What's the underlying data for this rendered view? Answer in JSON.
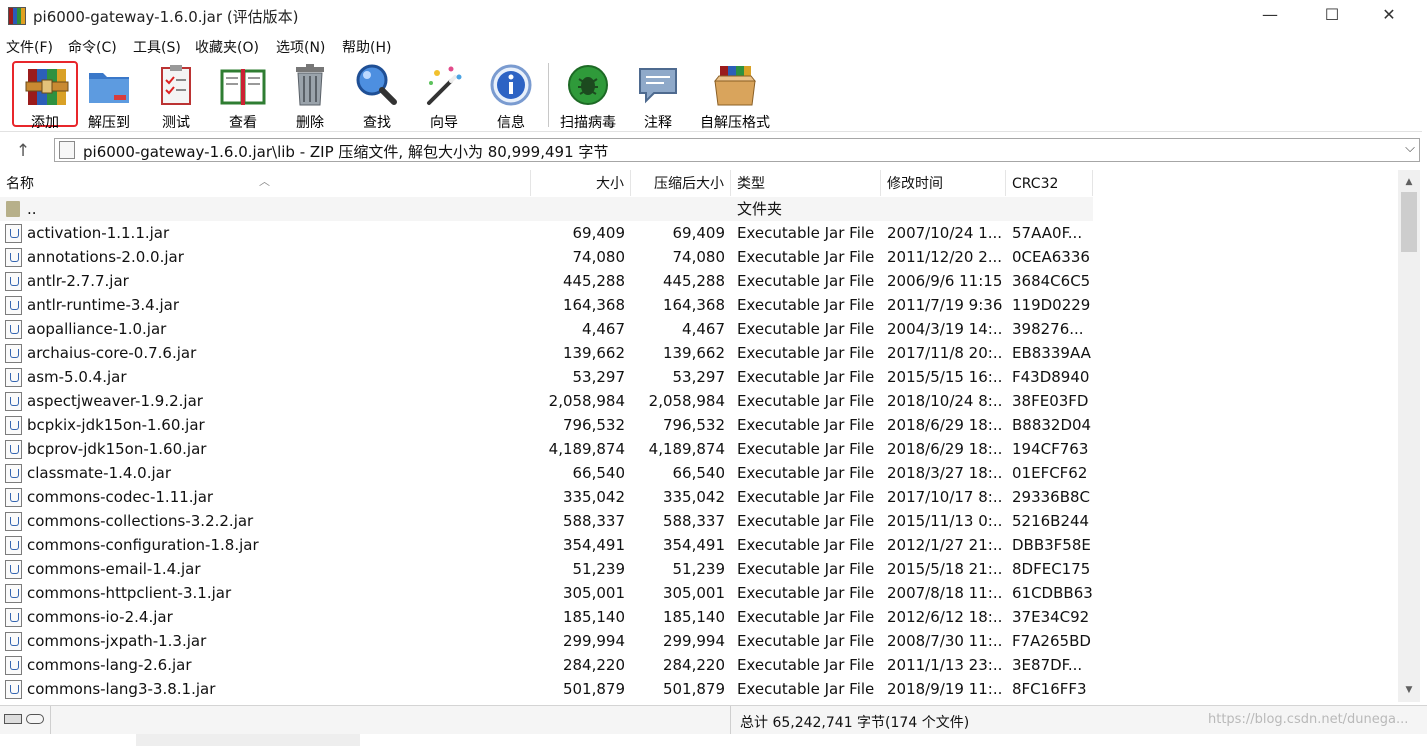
{
  "window": {
    "title": "pi6000-gateway-1.6.0.jar (评估版本)",
    "minimize": "—",
    "maximize": "☐",
    "close": "✕"
  },
  "menu": [
    "文件(F)",
    "命令(C)",
    "工具(S)",
    "收藏夹(O)",
    "选项(N)",
    "帮助(H)"
  ],
  "toolbar": {
    "add": "添加",
    "extract": "解压到",
    "test": "测试",
    "view": "查看",
    "delete": "删除",
    "find": "查找",
    "wizard": "向导",
    "info": "信息",
    "scan": "扫描病毒",
    "comment": "注释",
    "sfx": "自解压格式"
  },
  "address": {
    "path": "pi6000-gateway-1.6.0.jar\\lib - ZIP 压缩文件, 解包大小为 80,999,491 字节"
  },
  "columns": {
    "name": "名称",
    "size": "大小",
    "packed": "压缩后大小",
    "type": "类型",
    "modified": "修改时间",
    "crc": "CRC32"
  },
  "parent_row": {
    "name": "..",
    "type": "文件夹"
  },
  "files": [
    {
      "name": "activation-1.1.1.jar",
      "size": "69,409",
      "packed": "69,409",
      "type": "Executable Jar File",
      "modified": "2007/10/24 1...",
      "crc": "57AA0F..."
    },
    {
      "name": "annotations-2.0.0.jar",
      "size": "74,080",
      "packed": "74,080",
      "type": "Executable Jar File",
      "modified": "2011/12/20 2...",
      "crc": "0CEA6336"
    },
    {
      "name": "antlr-2.7.7.jar",
      "size": "445,288",
      "packed": "445,288",
      "type": "Executable Jar File",
      "modified": "2006/9/6 11:15",
      "crc": "3684C6C5"
    },
    {
      "name": "antlr-runtime-3.4.jar",
      "size": "164,368",
      "packed": "164,368",
      "type": "Executable Jar File",
      "modified": "2011/7/19 9:36",
      "crc": "119D0229"
    },
    {
      "name": "aopalliance-1.0.jar",
      "size": "4,467",
      "packed": "4,467",
      "type": "Executable Jar File",
      "modified": "2004/3/19 14:...",
      "crc": "398276..."
    },
    {
      "name": "archaius-core-0.7.6.jar",
      "size": "139,662",
      "packed": "139,662",
      "type": "Executable Jar File",
      "modified": "2017/11/8 20:...",
      "crc": "EB8339AA"
    },
    {
      "name": "asm-5.0.4.jar",
      "size": "53,297",
      "packed": "53,297",
      "type": "Executable Jar File",
      "modified": "2015/5/15 16:...",
      "crc": "F43D8940"
    },
    {
      "name": "aspectjweaver-1.9.2.jar",
      "size": "2,058,984",
      "packed": "2,058,984",
      "type": "Executable Jar File",
      "modified": "2018/10/24 8:...",
      "crc": "38FE03FD"
    },
    {
      "name": "bcpkix-jdk15on-1.60.jar",
      "size": "796,532",
      "packed": "796,532",
      "type": "Executable Jar File",
      "modified": "2018/6/29 18:...",
      "crc": "B8832D04"
    },
    {
      "name": "bcprov-jdk15on-1.60.jar",
      "size": "4,189,874",
      "packed": "4,189,874",
      "type": "Executable Jar File",
      "modified": "2018/6/29 18:...",
      "crc": "194CF763"
    },
    {
      "name": "classmate-1.4.0.jar",
      "size": "66,540",
      "packed": "66,540",
      "type": "Executable Jar File",
      "modified": "2018/3/27 18:...",
      "crc": "01EFCF62"
    },
    {
      "name": "commons-codec-1.11.jar",
      "size": "335,042",
      "packed": "335,042",
      "type": "Executable Jar File",
      "modified": "2017/10/17 8:...",
      "crc": "29336B8C"
    },
    {
      "name": "commons-collections-3.2.2.jar",
      "size": "588,337",
      "packed": "588,337",
      "type": "Executable Jar File",
      "modified": "2015/11/13 0:...",
      "crc": "5216B244"
    },
    {
      "name": "commons-configuration-1.8.jar",
      "size": "354,491",
      "packed": "354,491",
      "type": "Executable Jar File",
      "modified": "2012/1/27 21:...",
      "crc": "DBB3F58E"
    },
    {
      "name": "commons-email-1.4.jar",
      "size": "51,239",
      "packed": "51,239",
      "type": "Executable Jar File",
      "modified": "2015/5/18 21:...",
      "crc": "8DFEC175"
    },
    {
      "name": "commons-httpclient-3.1.jar",
      "size": "305,001",
      "packed": "305,001",
      "type": "Executable Jar File",
      "modified": "2007/8/18 11:...",
      "crc": "61CDBB63"
    },
    {
      "name": "commons-io-2.4.jar",
      "size": "185,140",
      "packed": "185,140",
      "type": "Executable Jar File",
      "modified": "2012/6/12 18:...",
      "crc": "37E34C92"
    },
    {
      "name": "commons-jxpath-1.3.jar",
      "size": "299,994",
      "packed": "299,994",
      "type": "Executable Jar File",
      "modified": "2008/7/30 11:...",
      "crc": "F7A265BD"
    },
    {
      "name": "commons-lang-2.6.jar",
      "size": "284,220",
      "packed": "284,220",
      "type": "Executable Jar File",
      "modified": "2011/1/13 23:...",
      "crc": "3E87DF..."
    },
    {
      "name": "commons-lang3-3.8.1.jar",
      "size": "501,879",
      "packed": "501,879",
      "type": "Executable Jar File",
      "modified": "2018/9/19 11:...",
      "crc": "8FC16FF3"
    }
  ],
  "status": {
    "summary": "总计 65,242,741 字节(174 个文件)",
    "watermark": "https://blog.csdn.net/dunega..."
  },
  "colors": {
    "selected_tool_border": "#e8262b",
    "parent_row_bg": "#f5f5f5",
    "scrollbar_thumb": "#cdcdcd"
  }
}
